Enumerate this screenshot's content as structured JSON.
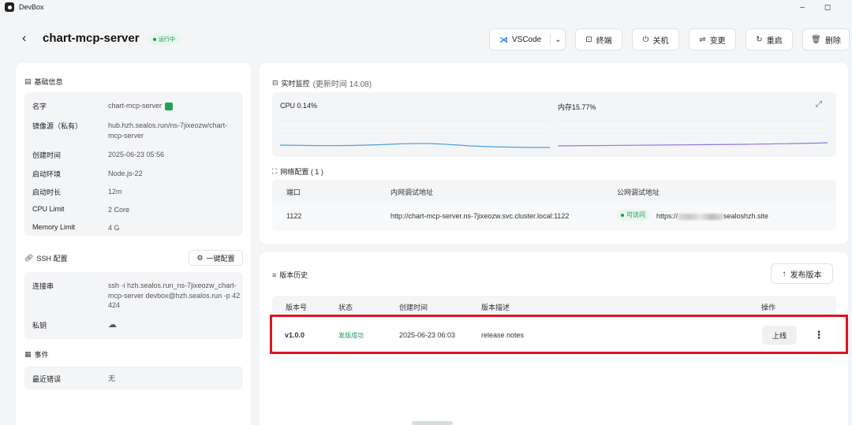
{
  "app": {
    "name": "DevBox",
    "minimize": "–",
    "restore": "◻"
  },
  "header": {
    "back": "‹",
    "title": "chart-mcp-server",
    "status": "运行中",
    "buttons": {
      "vscode": "VSCode",
      "terminal": "终端",
      "shutdown": "关机",
      "change": "变更",
      "restart": "重启",
      "delete": "删除"
    }
  },
  "basic": {
    "title": "基础信息",
    "rows": [
      {
        "key": "名字",
        "value": "chart-mcp-server"
      },
      {
        "key": "镜像源（私有）",
        "value": "hub.hzh.sealos.run/ns-7jixeozw/chart-mcp-server"
      },
      {
        "key": "创建时间",
        "value": "2025-06-23 05:56"
      },
      {
        "key": "启动环境",
        "value": "Node.js-22"
      },
      {
        "key": "启动时长",
        "value": "12m"
      },
      {
        "key": "CPU Limit",
        "value": "2 Core"
      },
      {
        "key": "Memory Limit",
        "value": "4 G"
      }
    ]
  },
  "ssh": {
    "title": "SSH 配置",
    "oneclick": "一键配置",
    "conn_key": "连接串",
    "conn_value": "ssh -i hzh.sealos.run_ns-7jixeozw_chart-mcp-server devbox@hzh.sealos.run -p 42424",
    "private_key": "私钥"
  },
  "events": {
    "title": "事件",
    "recent_error_key": "最近错误",
    "recent_error_value": "无"
  },
  "monitor": {
    "title": "实时监控",
    "updated": "(更新时间 14:08)",
    "cpu": "CPU 0.14%",
    "memory": "内存15.77%",
    "cpu_color": "#4aa3df",
    "mem_color": "#8c7ae6"
  },
  "network": {
    "title": "网络配置 ( 1 )",
    "headers": [
      "端口",
      "内网调试地址",
      "公网调试地址"
    ],
    "port": "1122",
    "internal": "http://chart-mcp-server.ns-7jixeozw.svc.cluster.local:1122",
    "access": "可访问",
    "public_prefix": "https://",
    "public_suffix": "sealoshzh.site"
  },
  "history": {
    "title": "版本历史",
    "publish": "发布版本",
    "headers": [
      "版本号",
      "状态",
      "创建时间",
      "版本描述",
      "操作"
    ],
    "row": {
      "version": "v1.0.0",
      "status": "发版成功",
      "created": "2025-06-23 06:03",
      "desc": "release notes",
      "online": "上线"
    }
  }
}
